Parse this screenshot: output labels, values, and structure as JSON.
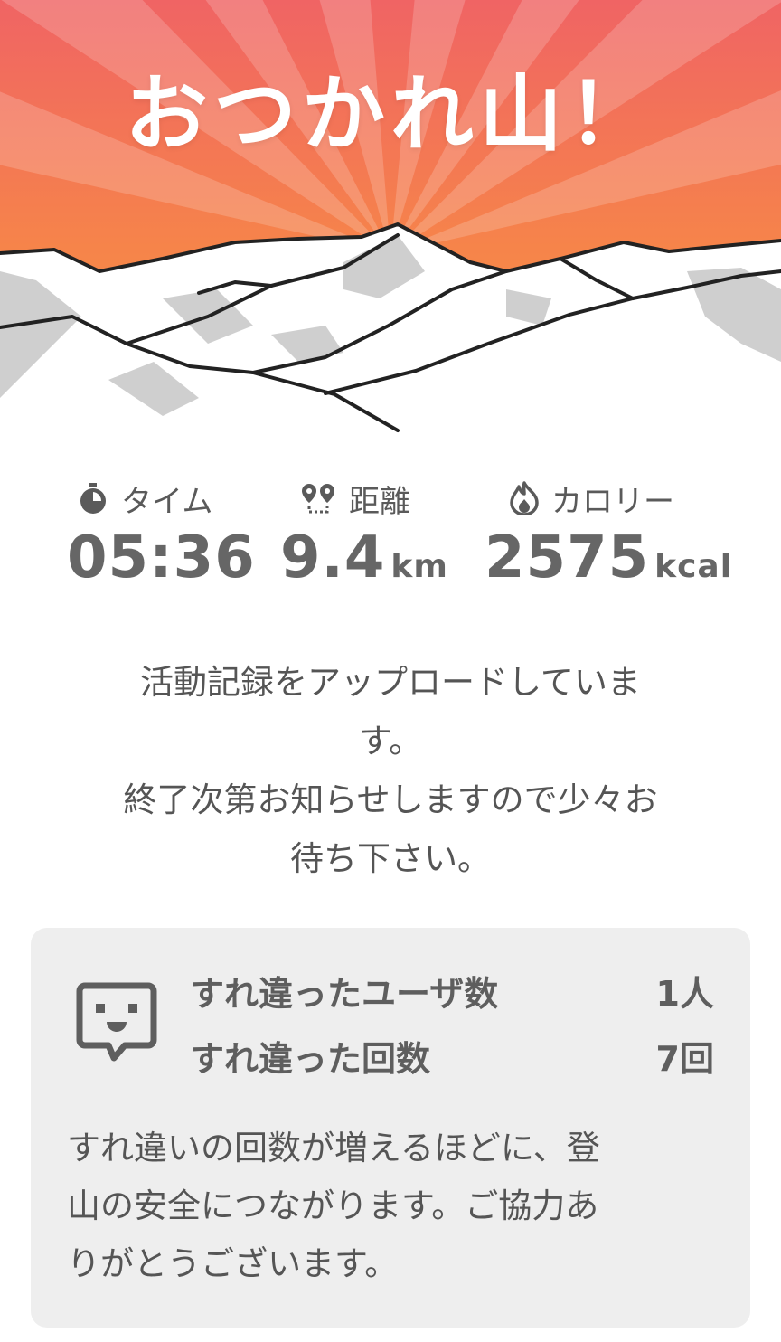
{
  "hero": {
    "title": "おつかれ山！"
  },
  "stats": {
    "time": {
      "label": "タイム",
      "value": "05:36",
      "icon": "stopwatch-icon"
    },
    "distance": {
      "label": "距離",
      "value": "9.4",
      "unit": "km",
      "icon": "route-pin-icon"
    },
    "calories": {
      "label": "カロリー",
      "value": "2575",
      "unit": "kcal",
      "icon": "flame-icon"
    }
  },
  "message": {
    "line1": "活動記録をアップロードしていま",
    "line2": "す。",
    "line3": "終了次第お知らせしますので少々お",
    "line4": "待ち下さい。"
  },
  "encounter": {
    "icon": "smiley-speech-icon",
    "users_label": "すれ違ったユーザ数",
    "users_value": "1人",
    "count_label": "すれ違った回数",
    "count_value": "7回",
    "note_line1": "すれ違いの回数が増えるほどに、登",
    "note_line2": "山の安全につながります。ご協力あ",
    "note_line3": "りがとうございます。"
  },
  "colors": {
    "sky_top": "#f06a5a",
    "sky_bottom": "#f7903f",
    "ray_light": "#f8a070",
    "text_gray": "#555555",
    "card_bg": "#eeeeee"
  }
}
